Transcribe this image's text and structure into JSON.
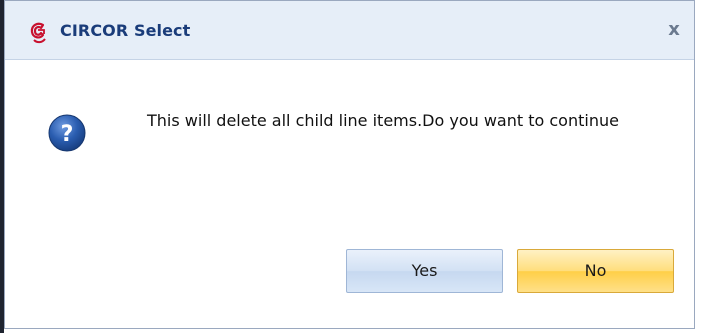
{
  "dialog": {
    "title": "CIRCOR Select",
    "close_glyph": "x",
    "app_icon": "circor-logo-icon",
    "message_icon": "question-icon",
    "message": "This will delete all child line items.Do you want to continue",
    "buttons": {
      "yes_label": "Yes",
      "no_label": "No"
    }
  },
  "colors": {
    "title_text": "#1a3c7a",
    "titlebar_bg": "#e6eef8",
    "logo_red": "#c8102e",
    "question_blue": "#1f4e9a",
    "yes_button": "#d2e1f4",
    "no_button": "#ffcf47"
  }
}
